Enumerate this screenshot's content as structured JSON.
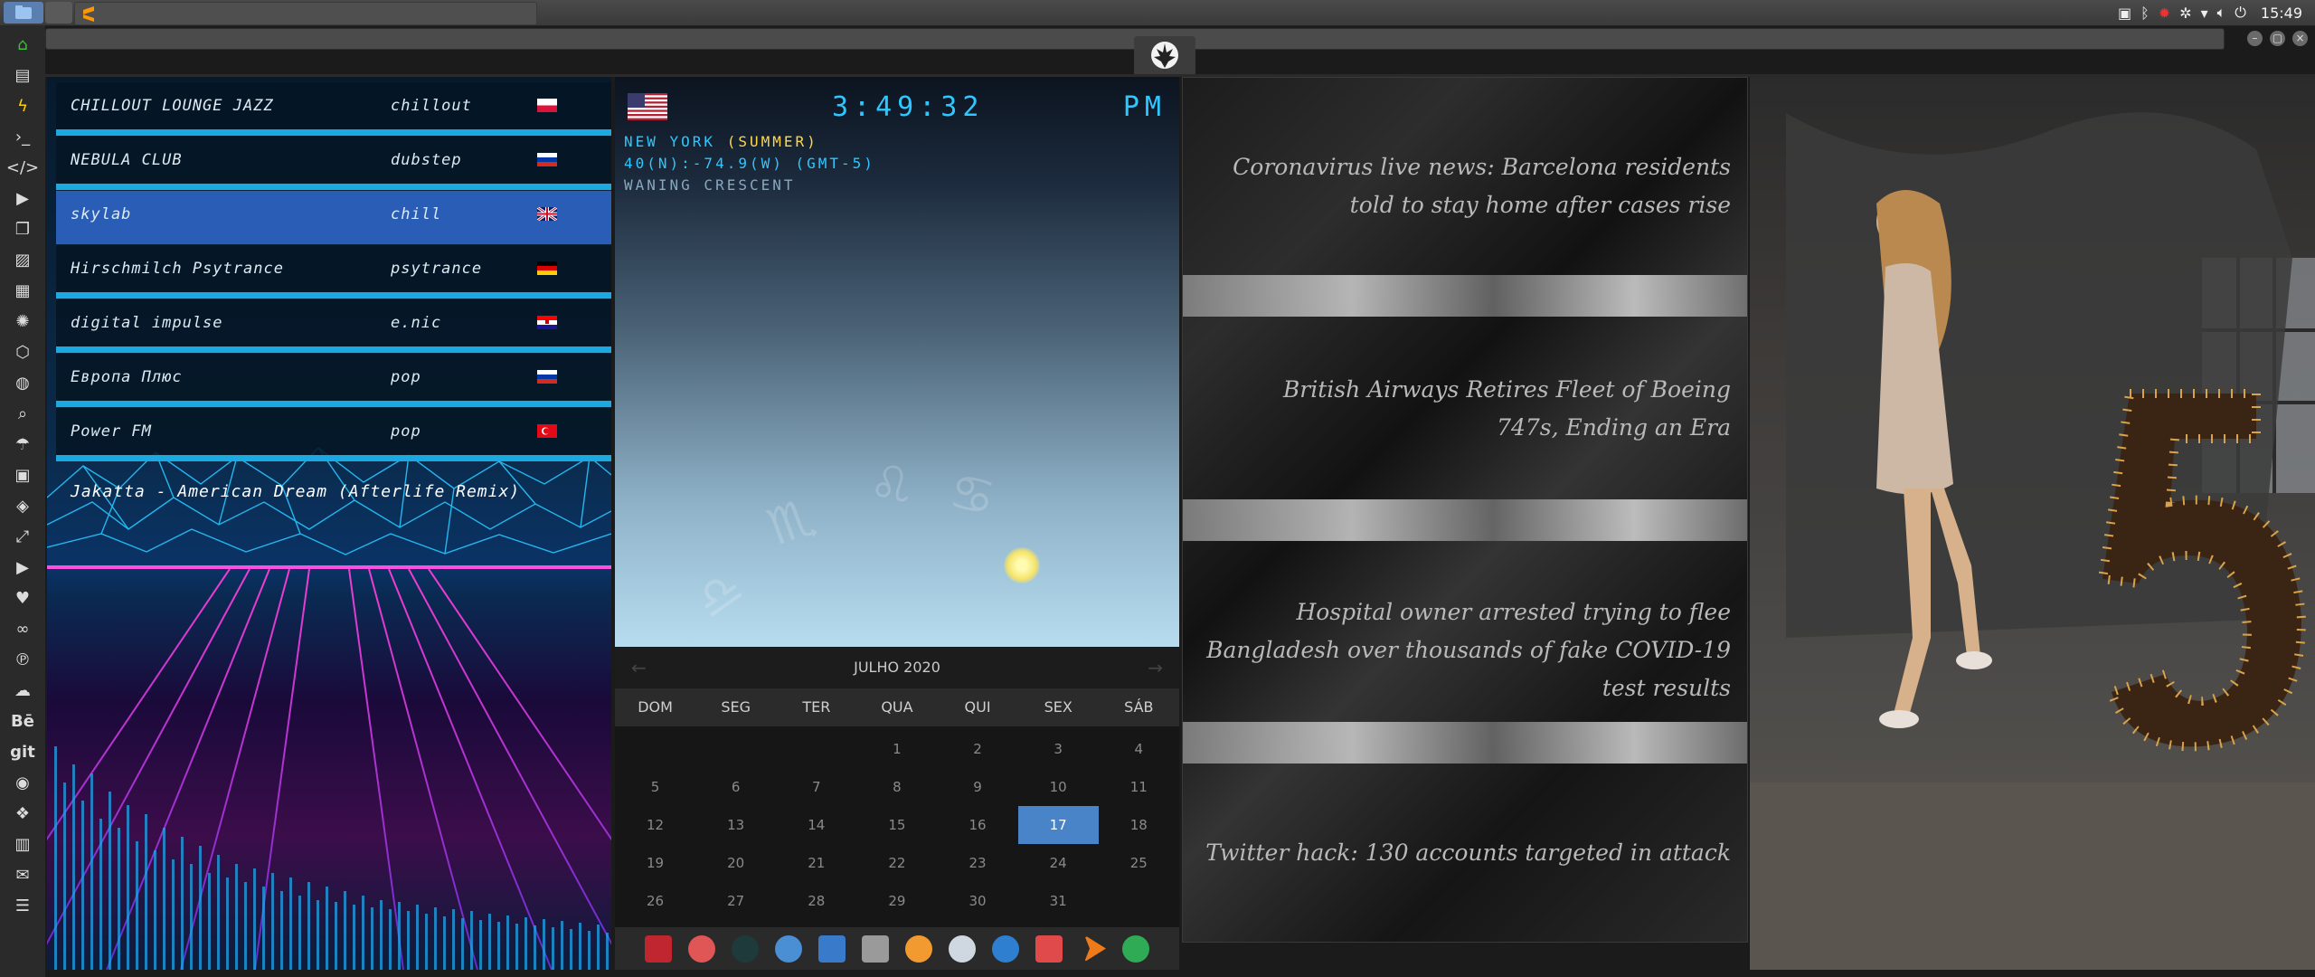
{
  "top_panel": {
    "clock": "15:49"
  },
  "radio": {
    "stations": [
      {
        "name": "CHILLOUT LOUNGE JAZZ",
        "genre": "chillout",
        "flag": "poland"
      },
      {
        "name": "NEBULA CLUB",
        "genre": "dubstep",
        "flag": "russia"
      },
      {
        "name": "skylab",
        "genre": "chill",
        "flag": "uk"
      },
      {
        "name": "Hirschmilch Psytrance",
        "genre": "psytrance",
        "flag": "germany"
      },
      {
        "name": "digital impulse",
        "genre": "e.nic",
        "flag": "croatia"
      },
      {
        "name": "Европа Плюс",
        "genre": "pop",
        "flag": "russia"
      },
      {
        "name": "Power FM",
        "genre": "pop",
        "flag": "turkey"
      }
    ],
    "selected_index": 2,
    "now_playing": "Jakatta - American Dream (Afterlife Remix)"
  },
  "clock_widget": {
    "time": "3:49:32",
    "ampm": "PM",
    "city_prefix": "NEW YORK ",
    "city_season": "(SUMMER)",
    "coords": "40(N):-74.9(W) (GMT-5)",
    "moon_phase": "WANING CRESCENT"
  },
  "calendar": {
    "month_label": "JULHO 2020",
    "weekdays": [
      "DOM",
      "SEG",
      "TER",
      "QUA",
      "QUI",
      "SEX",
      "SÁB"
    ],
    "weeks": [
      [
        "",
        "",
        "",
        "1",
        "2",
        "3",
        "4"
      ],
      [
        "5",
        "6",
        "7",
        "8",
        "9",
        "10",
        "11"
      ],
      [
        "12",
        "13",
        "14",
        "15",
        "16",
        "17",
        "18"
      ],
      [
        "19",
        "20",
        "21",
        "22",
        "23",
        "24",
        "25"
      ],
      [
        "26",
        "27",
        "28",
        "29",
        "30",
        "31",
        ""
      ]
    ],
    "today": "17"
  },
  "news": [
    "Coronavirus live news: Barcelona residents told to stay home after cases rise",
    "British Airways Retires Fleet of Boeing 747s, Ending an Era",
    "Hospital owner arrested trying to flee Bangladesh over thousands of fake COVID-19 test results",
    "Twitter hack: 130 accounts targeted in attack"
  ],
  "sidebar": {
    "text_items": [
      "Bē",
      "git"
    ]
  },
  "colors": {
    "accent_blue": "#2ec7ff",
    "selected_row": "#2a5db6",
    "today_cell": "#4a84c8"
  }
}
